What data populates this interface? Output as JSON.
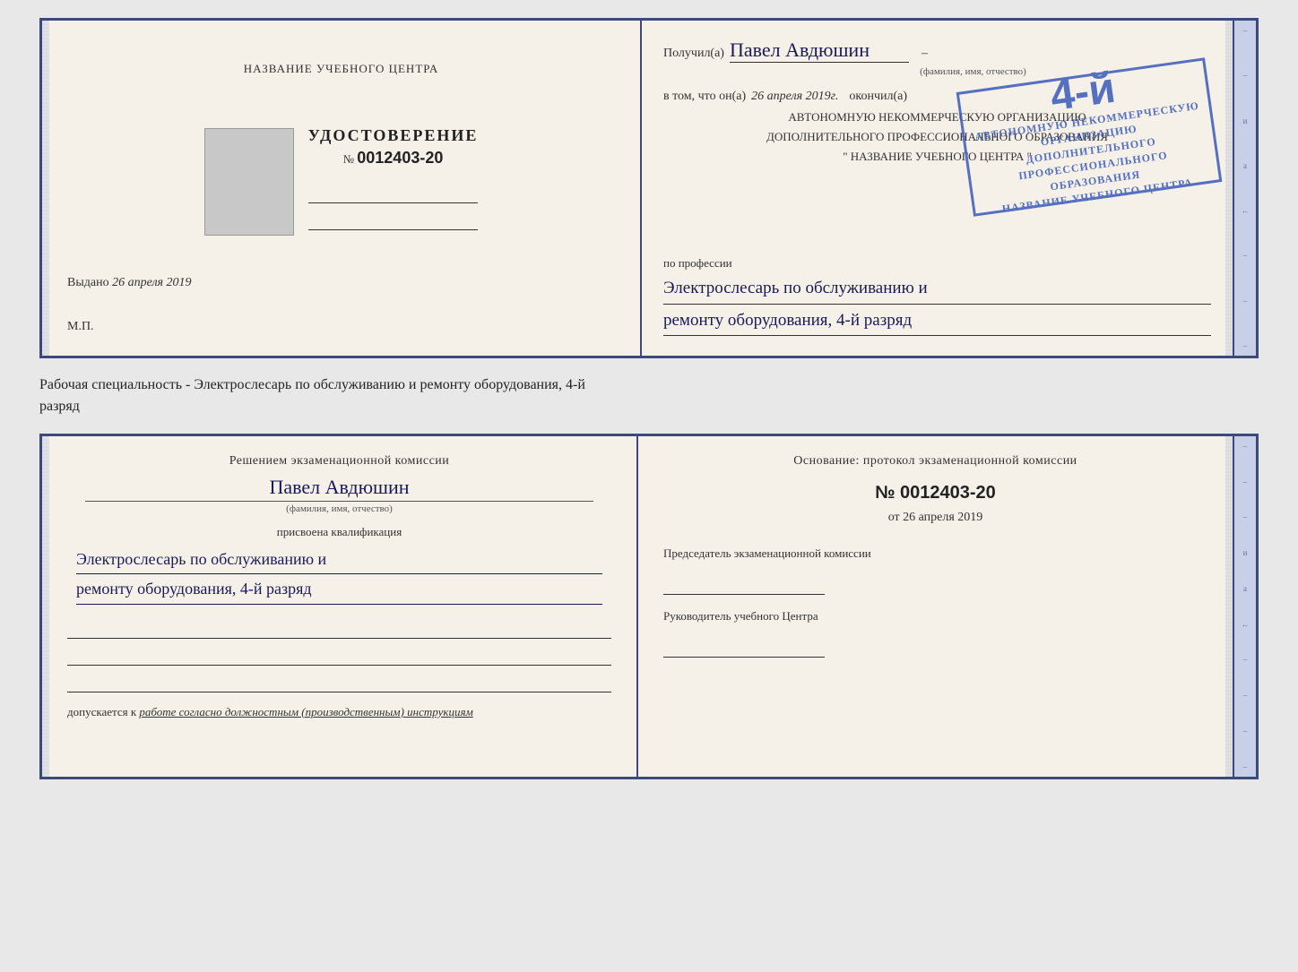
{
  "page": {
    "background": "#e8e8e8"
  },
  "top_document": {
    "left": {
      "title": "НАЗВАНИЕ УЧЕБНОГО ЦЕНТРА",
      "cert_word": "УДОСТОВЕРЕНИЕ",
      "cert_number_prefix": "№",
      "cert_number": "0012403-20",
      "issued_label": "Выдано",
      "issued_date": "26 апреля 2019",
      "mp_label": "М.П."
    },
    "right": {
      "received_label": "Получил(а)",
      "person_name": "Павел Авдюшин",
      "fio_label": "(фамилия, имя, отчество)",
      "vtom_label": "в том, что он(а)",
      "date_text": "26 апреля 2019г.",
      "finished_label": "окончил(а)",
      "org_line1": "АВТОНОМНУЮ НЕКОММЕРЧЕСКУЮ ОРГАНИЗАЦИЮ",
      "org_line2": "ДОПОЛНИТЕЛЬНОГО ПРОФЕССИОНАЛЬНОГО ОБРАЗОВАНИЯ",
      "org_name": "\" НАЗВАНИЕ УЧЕБНОГО ЦЕНТРА \"",
      "profession_label": "по профессии",
      "profession_line1": "Электрослесарь по обслуживанию и",
      "profession_line2": "ремонту оборудования, 4-й разряд"
    },
    "stamp": {
      "number": "4-й",
      "line1": "АВТОНОМНУЮ НЕКОММЕРЧЕСКУЮ ОРГАНИЗАЦИЮ",
      "line2": "ДОПОЛНИТЕЛЬНОГО ПРОФЕССИОНАЛЬНОГО ОБРАЗОВАНИЯ",
      "line3": "НАЗВАНИЕ УЧЕБНОГО ЦЕНТРА"
    }
  },
  "between_text": {
    "line1": "Рабочая специальность - Электрослесарь по обслуживанию и ремонту оборудования, 4-й",
    "line2": "разряд"
  },
  "bottom_document": {
    "left": {
      "commission_title": "Решением экзаменационной комиссии",
      "person_name": "Павел Авдюшин",
      "fio_label": "(фамилия, имя, отчество)",
      "assigned_label": "присвоена квалификация",
      "qual_line1": "Электрослесарь по обслуживанию и",
      "qual_line2": "ремонту оборудования, 4-й разряд",
      "допускается_label": "допускается к",
      "допускается_italic": "работе согласно должностным (производственным) инструкциям"
    },
    "right": {
      "osnov_label": "Основание: протокол экзаменационной комиссии",
      "number_prefix": "№",
      "protocol_number": "0012403-20",
      "from_prefix": "от",
      "from_date": "26 апреля 2019",
      "chairman_label": "Председатель экзаменационной комиссии",
      "head_label": "Руководитель учебного Центра"
    }
  },
  "edge_marks": {
    "top": [
      "–",
      "–",
      "a",
      "←",
      "–",
      "–",
      "–",
      "–"
    ],
    "bottom": [
      "–",
      "–",
      "и",
      "a",
      "←",
      "–",
      "–",
      "–",
      "–"
    ]
  }
}
